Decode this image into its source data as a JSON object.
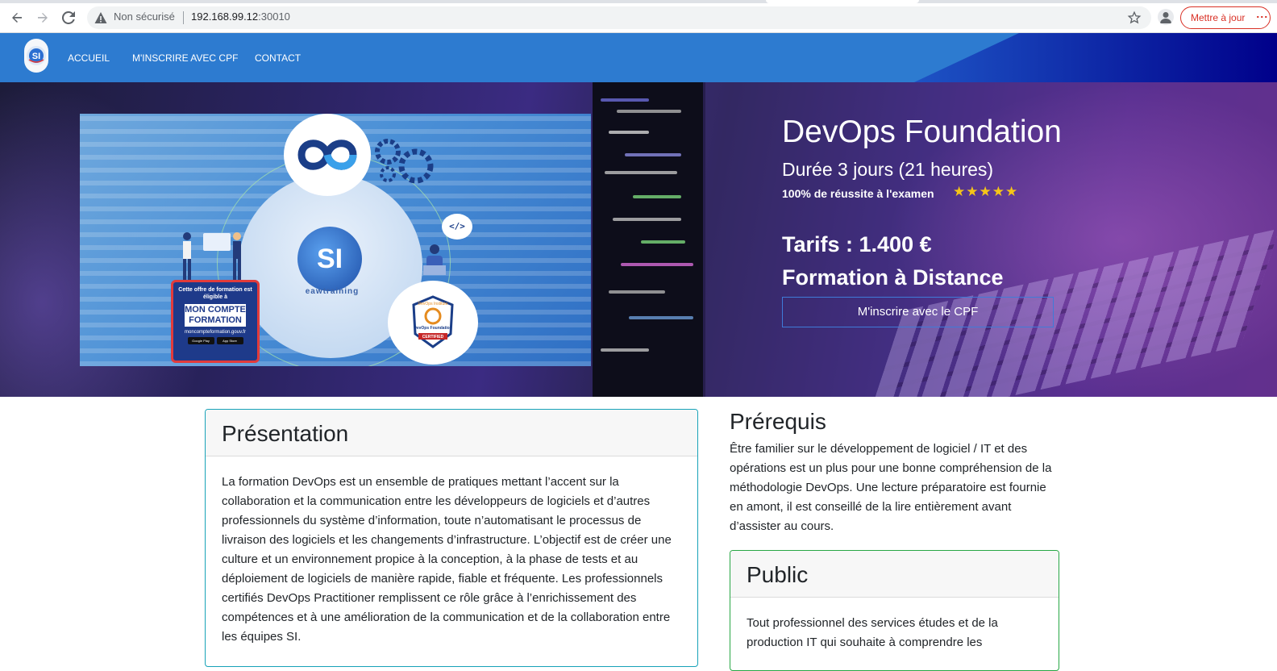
{
  "browser": {
    "security_label": "Non sécurisé",
    "url_host": "192.168.99.12",
    "url_port": ":30010",
    "update_label": "Mettre à jour"
  },
  "nav": {
    "items": [
      {
        "label": "ACCUEIL"
      },
      {
        "label": "M'INSCRIRE AVEC CPF"
      },
      {
        "label": "CONTACT"
      }
    ]
  },
  "promo": {
    "devops_left": "Dev",
    "devops_right": "Ops",
    "code_tag": "</>",
    "cpf_line1": "Cette offre de formation est éligible à",
    "cpf_line2": "MON COMPTE FORMATION",
    "cpf_site": "moncompteformation.gouv.fr",
    "store1": "Google Play",
    "store2": "App Store",
    "brand_text": "eawtraining",
    "cert_line1": "DevOps Institute",
    "cert_line2": "DevOps Foundation",
    "cert_line3": "CERTIFIED"
  },
  "hero": {
    "title": "DevOps Foundation",
    "duration": "Durée 3 jours (21 heures)",
    "success": "100% de réussite à l'examen",
    "stars": "★★★★★",
    "price": "Tarifs : 1.400 €",
    "mode": "Formation à Distance",
    "cta": "M'inscrire avec le CPF"
  },
  "presentation": {
    "title": "Présentation",
    "text": "La formation DevOps est un ensemble de pratiques mettant l’accent sur la collaboration et la communication entre les développeurs de logiciels et d’autres professionnels du système d’information, toute n’automatisant le processus de livraison des logiciels et les changements d’infrastructure. L’objectif est de créer une culture et un environnement propice à la conception, à la phase de tests et au déploiement de logiciels de manière rapide, fiable et fréquente. Les professionnels certifiés DevOps Practitioner remplissent ce rôle grâce à l’enrichissement des compétences et à une amélioration de la communication et de la collaboration entre les équipes SI."
  },
  "prerequis": {
    "title": "Prérequis",
    "text": "Être familier sur le développement de logiciel / IT et des opérations est un plus pour une bonne compréhension de la méthodologie DevOps. Une lecture préparatoire est fournie en amont, il est conseillé de la lire entièrement avant d’assister au cours."
  },
  "public": {
    "title": "Public",
    "text": "Tout professionnel des services études et de la production IT qui souhaite à comprendre les"
  },
  "colors": {
    "nav_blue": "#2d7bd0",
    "nav_dark": "#0a0aa0",
    "presentation_border": "#17a2b8",
    "public_border": "#28a745",
    "star_color": "#f5c518",
    "update_red": "#d93025"
  }
}
